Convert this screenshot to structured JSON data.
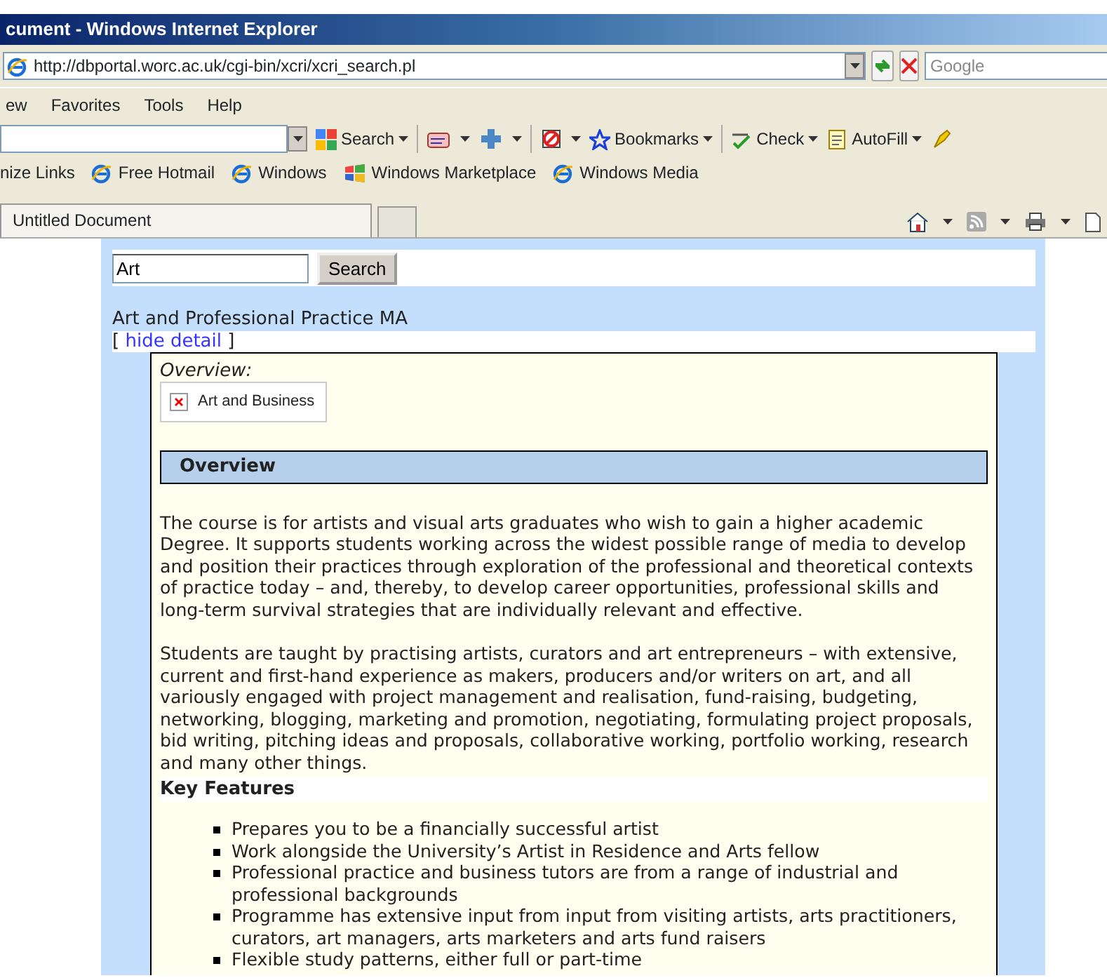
{
  "window": {
    "title": "cument - Windows Internet Explorer"
  },
  "address_bar": {
    "url": "http://dbportal.worc.ac.uk/cgi-bin/xcri/xcri_search.pl",
    "search_placeholder": "Google"
  },
  "menu": [
    "ew",
    "Favorites",
    "Tools",
    "Help"
  ],
  "toolbar": [
    {
      "kind": "search",
      "label": "Search"
    },
    {
      "kind": "bookmarks",
      "label": "Bookmarks"
    },
    {
      "kind": "check",
      "label": "Check"
    },
    {
      "kind": "autofill",
      "label": "AutoFill"
    }
  ],
  "links": [
    {
      "kind": "plain",
      "label": "nize Links"
    },
    {
      "kind": "ie",
      "label": "Free Hotmail"
    },
    {
      "kind": "ie",
      "label": "Windows"
    },
    {
      "kind": "market",
      "label": "Windows Marketplace"
    },
    {
      "kind": "ie",
      "label": "Windows Media"
    }
  ],
  "tabs": [
    {
      "label": "Untitled Document",
      "selected": true
    }
  ],
  "page": {
    "search_value": "Art",
    "search_button": "Search",
    "course_title": "Art and Professional Practice MA",
    "toggle_open": "[",
    "toggle_link": "hide detail",
    "toggle_close": "]",
    "overview_label": "Overview:",
    "image_alt": "Art and Business",
    "section_heading": "Overview",
    "paragraphs": [
      "The course is for artists and visual arts graduates who wish to gain a higher academic Degree. It supports students working across the widest possible range of media to develop and position their practices through exploration of the professional and theoretical contexts of practice today – and, thereby, to develop career opportunities, professional skills and long-term survival strategies that are individually relevant and effective.",
      "Students are taught by practising artists, curators and art entrepreneurs – with extensive, current and first-hand experience as makers, producers and/or writers on art, and all variously engaged with project management and realisation, fund-raising, budgeting, networking, blogging, marketing and promotion, negotiating, formulating project proposals, bid writing, pitching ideas and proposals, collaborative working, portfolio working, research and many other things."
    ],
    "features_heading": "Key Features",
    "features": [
      "Prepares you to be a financially successful artist",
      "Work alongside the University’s Artist in Residence and Arts fellow",
      "Professional practice and business tutors are from a range of industrial and professional backgrounds",
      "Programme has extensive input from input from visiting artists, arts practitioners, curators, art managers, arts marketers and arts fund raisers",
      "Flexible study patterns, either full or part-time"
    ]
  }
}
